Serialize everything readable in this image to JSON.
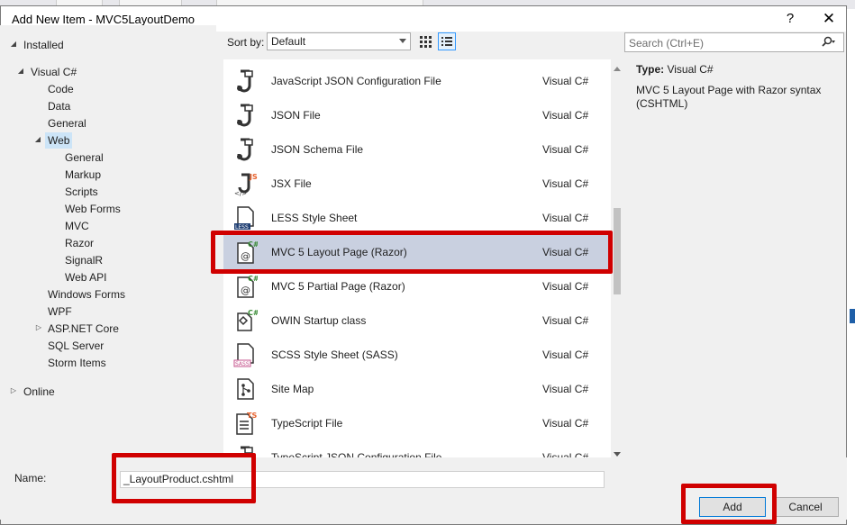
{
  "dialog": {
    "title": "Add New Item - MVC5LayoutDemo",
    "help_glyph": "?",
    "close_glyph": "✕"
  },
  "tree": {
    "installed": "Installed",
    "visual_csharp": "Visual C#",
    "code": "Code",
    "data": "Data",
    "general": "General",
    "web": "Web",
    "web_children": [
      "General",
      "Markup",
      "Scripts",
      "Web Forms",
      "MVC",
      "Razor",
      "SignalR",
      "Web API"
    ],
    "windows_forms": "Windows Forms",
    "wpf": "WPF",
    "aspnet_core": "ASP.NET Core",
    "sql_server": "SQL Server",
    "storm_items": "Storm Items",
    "online": "Online"
  },
  "sort": {
    "label": "Sort by:",
    "value": "Default"
  },
  "search": {
    "placeholder": "Search (Ctrl+E)"
  },
  "templates": [
    {
      "name": "JavaScript JSON Configuration File",
      "lang": "Visual C#",
      "icon": "json-file-icon"
    },
    {
      "name": "JSON File",
      "lang": "Visual C#",
      "icon": "json-file-icon"
    },
    {
      "name": "JSON Schema File",
      "lang": "Visual C#",
      "icon": "json-file-icon"
    },
    {
      "name": "JSX File",
      "lang": "Visual C#",
      "icon": "jsx-file-icon"
    },
    {
      "name": "LESS Style Sheet",
      "lang": "Visual C#",
      "icon": "less-file-icon"
    },
    {
      "name": "MVC 5 Layout Page (Razor)",
      "lang": "Visual C#",
      "icon": "razor-page-icon",
      "selected": true
    },
    {
      "name": "MVC 5 Partial Page (Razor)",
      "lang": "Visual C#",
      "icon": "razor-page-icon"
    },
    {
      "name": "OWIN Startup class",
      "lang": "Visual C#",
      "icon": "owin-class-icon"
    },
    {
      "name": "SCSS Style Sheet (SASS)",
      "lang": "Visual C#",
      "icon": "sass-file-icon"
    },
    {
      "name": "Site Map",
      "lang": "Visual C#",
      "icon": "sitemap-icon"
    },
    {
      "name": "TypeScript File",
      "lang": "Visual C#",
      "icon": "typescript-file-icon"
    },
    {
      "name": "TypeScript JSON Configuration File",
      "lang": "Visual C#",
      "icon": "json-file-icon"
    }
  ],
  "details": {
    "type_label": "Type:",
    "type_value": "Visual C#",
    "description": "MVC 5 Layout Page with Razor syntax (CSHTML)"
  },
  "bottom": {
    "name_label": "Name:",
    "name_value": "_LayoutProduct.cshtml",
    "add_label": "Add",
    "cancel_label": "Cancel"
  },
  "colors": {
    "highlight": "#d00000",
    "selection": "#c9d0e0",
    "tree_selection": "#cce4f7"
  }
}
